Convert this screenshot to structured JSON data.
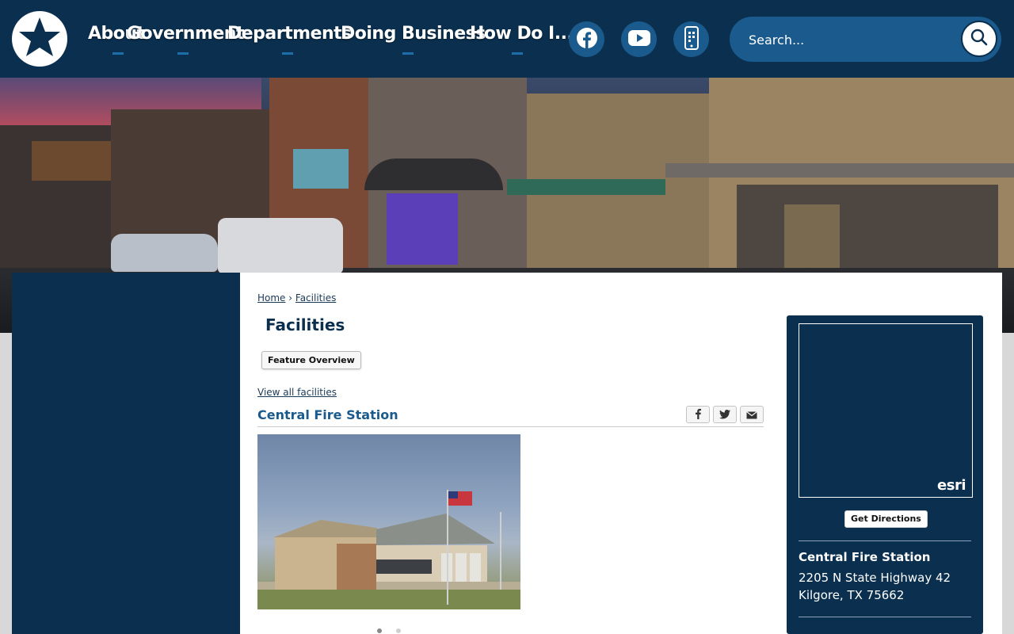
{
  "header": {
    "nav": [
      {
        "label": "About"
      },
      {
        "label": "Government"
      },
      {
        "label": "Departments"
      },
      {
        "label": "Doing Business"
      },
      {
        "label": "How Do I..."
      }
    ],
    "social": [
      {
        "icon": "facebook-icon"
      },
      {
        "icon": "youtube-icon"
      },
      {
        "icon": "mobile-app-icon"
      }
    ],
    "search": {
      "placeholder": "Search..."
    }
  },
  "breadcrumb": {
    "home": "Home",
    "separator": "›",
    "current": "Facilities"
  },
  "main": {
    "title": "Facilities",
    "feature_button": "Feature Overview",
    "view_all": "View all facilities",
    "facility_name": "Central Fire Station",
    "share_icons": [
      "facebook-icon",
      "twitter-icon",
      "email-icon"
    ]
  },
  "map_card": {
    "attribution": "esri",
    "directions_button": "Get Directions",
    "name": "Central Fire Station",
    "address_line1": "2205 N State Highway 42",
    "address_line2": "Kilgore, TX 75662"
  },
  "colors": {
    "header_bg": "#0b2f4e",
    "accent": "#1a5a8c",
    "link": "#1b3a57"
  }
}
